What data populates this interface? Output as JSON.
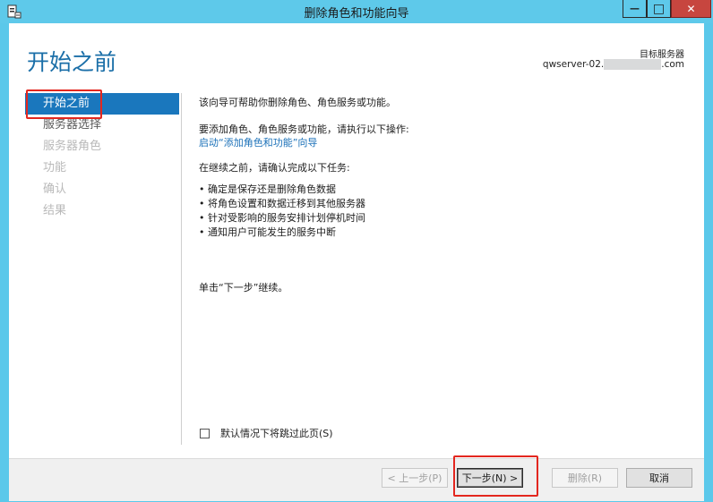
{
  "window": {
    "title": "删除角色和功能向导",
    "min_symbol": "—",
    "max_symbol": "□",
    "close_symbol": "✕"
  },
  "header": {
    "page_title": "开始之前",
    "target_label": "目标服务器",
    "target_prefix": "qwserver-02.",
    "target_suffix": ".com"
  },
  "nav": {
    "items": [
      {
        "label": "开始之前",
        "state": "active"
      },
      {
        "label": "服务器选择",
        "state": "enabled"
      },
      {
        "label": "服务器角色",
        "state": "disabled"
      },
      {
        "label": "功能",
        "state": "disabled"
      },
      {
        "label": "确认",
        "state": "disabled"
      },
      {
        "label": "结果",
        "state": "disabled"
      }
    ]
  },
  "content": {
    "intro": "该向导可帮助你删除角色、角色服务或功能。",
    "add_instruction": "要添加角色、角色服务或功能，请执行以下操作:",
    "add_link": "启动“添加角色和功能”向导",
    "prereq": "在继续之前，请确认完成以下任务:",
    "tasks": [
      "确定是保存还是删除角色数据",
      "将角色设置和数据迁移到其他服务器",
      "针对受影响的服务安排计划停机时间",
      "通知用户可能发生的服务中断"
    ],
    "continue_text": "单击“下一步”继续。"
  },
  "skip_checkbox": {
    "label": "默认情况下将跳过此页(S)",
    "checked": false
  },
  "buttons": {
    "prev": "< 上一步(P)",
    "next": "下一步(N) >",
    "remove": "删除(R)",
    "cancel": "取消"
  },
  "colors": {
    "titlebar": "#5ec9ea",
    "accent": "#1a77bd",
    "highlight": "#e3271f"
  }
}
